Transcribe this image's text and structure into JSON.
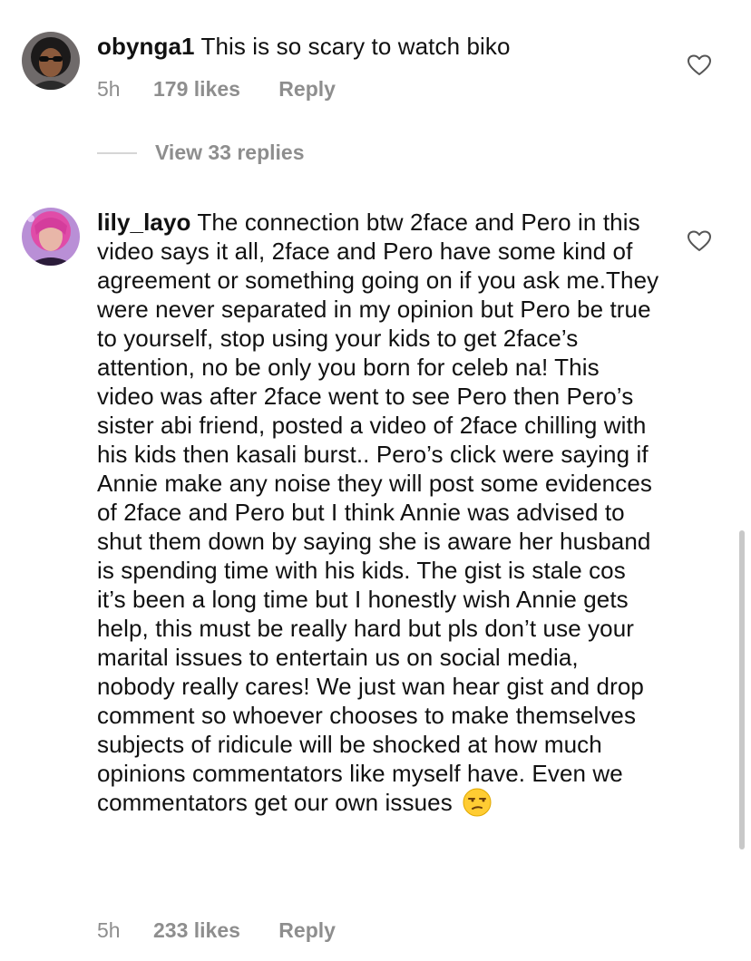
{
  "comments": [
    {
      "username": "obynga1",
      "text": "This is so scary to watch biko",
      "time": "5h",
      "likes": "179 likes",
      "reply_label": "Reply",
      "view_replies_label": "View 33 replies",
      "avatar_icon": "avatar-woman-sunglasses",
      "heart_icon": "heart-outline-icon"
    },
    {
      "username": "lily_layo",
      "text": "The connection btw 2face and Pero in this video says it all, 2face and Pero have some kind of agreement or something going on if you ask me.They were never separated in my opinion but Pero be true to yourself, stop using your kids to get 2face’s attention, no be only you born for celeb na! This video was after 2face went to see Pero then Pero’s sister abi friend, posted a video of 2face chilling with his kids then kasali burst.. Pero’s click were saying if Annie make any noise they will post some evidences of 2face and Pero but I think Annie was advised to  shut them down by saying she is aware her husband is spending time with his kids. The gist is stale cos it’s been a long time but I honestly wish Annie gets help, this must be really hard but pls don’t use your marital issues to entertain us on social media, nobody really cares! We just wan hear gist and drop comment so whoever chooses to make themselves subjects of ridicule will be shocked at how much opinions commentators like myself have. Even we commentators get our own issues",
      "emoji": "unamused-face-emoji",
      "time2": "5h",
      "likes2": "233 likes",
      "reply_label2": "Reply",
      "avatar_icon": "avatar-pink-hair",
      "heart_icon": "heart-outline-icon"
    }
  ],
  "colors": {
    "text": "#111111",
    "meta": "#8e8e8e",
    "divider": "#d6d6d6"
  }
}
